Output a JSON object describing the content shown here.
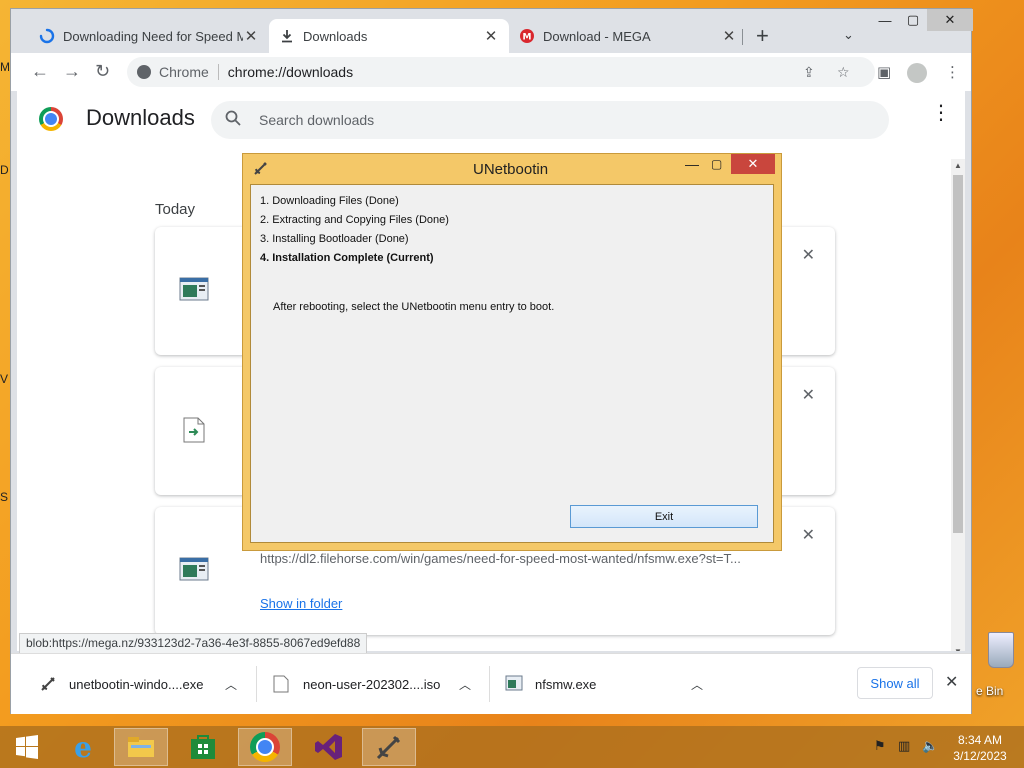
{
  "desktop": {
    "edge_labels": [
      "M",
      "D",
      "V",
      "S"
    ],
    "recycle_bin_label": "e Bin"
  },
  "browser": {
    "tabs": [
      {
        "title": "Downloading Need for Speed M",
        "favicon": "loading-spinner-icon"
      },
      {
        "title": "Downloads",
        "favicon": "download-icon"
      },
      {
        "title": "Download - MEGA",
        "favicon": "mega-icon"
      }
    ],
    "address": {
      "site": "Chrome",
      "url": "chrome://downloads"
    }
  },
  "downloads_page": {
    "title": "Downloads",
    "search_placeholder": "Search downloads",
    "section_label": "Today",
    "cards": [
      {
        "icon": "exe-file-icon"
      },
      {
        "icon": "iso-file-icon"
      },
      {
        "icon": "exe-file-icon",
        "url": "https://dl2.filehorse.com/win/games/need-for-speed-most-wanted/nfsmw.exe?st=T...",
        "show_in_folder": "Show in folder"
      }
    ]
  },
  "status_url": "blob:https://mega.nz/933123d2-7a36-4e3f-8855-8067ed9efd88",
  "download_shelf": {
    "items": [
      {
        "name": "unetbootin-windo....exe",
        "icon": "unetbootin-icon"
      },
      {
        "name": "neon-user-202302....iso",
        "icon": "iso-file-icon"
      },
      {
        "name": "nfsmw.exe",
        "icon": "exe-file-icon"
      }
    ],
    "show_all": "Show all"
  },
  "dialog": {
    "title": "UNetbootin",
    "steps": [
      "1. Downloading Files (Done)",
      "2. Extracting and Copying Files (Done)",
      "3. Installing Bootloader (Done)",
      "4. Installation Complete (Current)"
    ],
    "message": "After rebooting, select the UNetbootin menu entry to boot.",
    "exit_label": "Exit"
  },
  "taskbar": {
    "apps": [
      "start-icon",
      "ie-icon",
      "file-explorer-icon",
      "store-icon",
      "chrome-icon",
      "visual-studio-icon",
      "unetbootin-icon"
    ],
    "time": "8:34 AM",
    "date": "3/12/2023"
  },
  "colors": {
    "accent": "#1a73e8",
    "dialog_frame": "#f4c868",
    "close_red": "#c9463d"
  }
}
